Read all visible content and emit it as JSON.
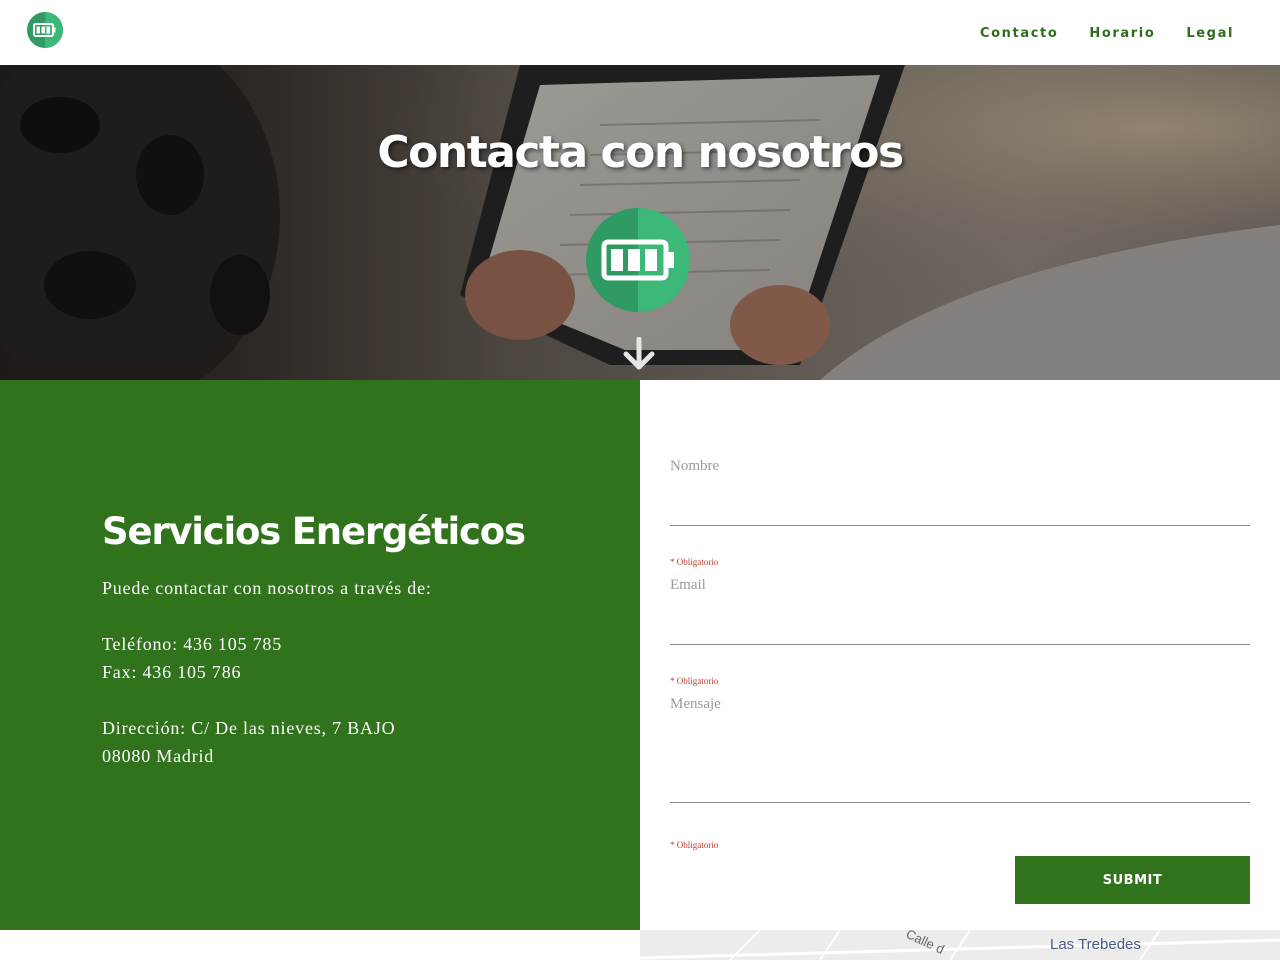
{
  "header": {
    "logo_icon": "battery-icon",
    "nav": [
      {
        "label": "Contacto"
      },
      {
        "label": "Horario"
      },
      {
        "label": "Legal"
      }
    ]
  },
  "hero": {
    "title": "Contacta con nosotros",
    "logo_icon": "battery-icon",
    "scroll_icon": "arrow-down-icon"
  },
  "info": {
    "heading": "Servicios Energéticos",
    "intro": "Puede contactar con nosotros a través de:",
    "phone": "Teléfono: 436 105 785",
    "fax": "Fax: 436 105 786",
    "address_line1": "Dirección: C/ De las nieves, 7 BAJO",
    "address_line2": "08080 Madrid"
  },
  "form": {
    "fields": [
      {
        "label": "Nombre",
        "value": "",
        "required_note": "* Obligatorio"
      },
      {
        "label": "Email",
        "value": "",
        "required_note": "* Obligatorio"
      },
      {
        "label": "Mensaje",
        "value": "",
        "required_note": "* Obligatorio"
      }
    ],
    "submit_label": "SUBMIT"
  },
  "map": {
    "place_label": "Las Trebedes",
    "street_label": "Calle d"
  },
  "colors": {
    "brand_green": "#31721d",
    "logo_green_dark": "#2f9a63",
    "logo_green_light": "#3cb878",
    "required_red": "#c0392b"
  }
}
